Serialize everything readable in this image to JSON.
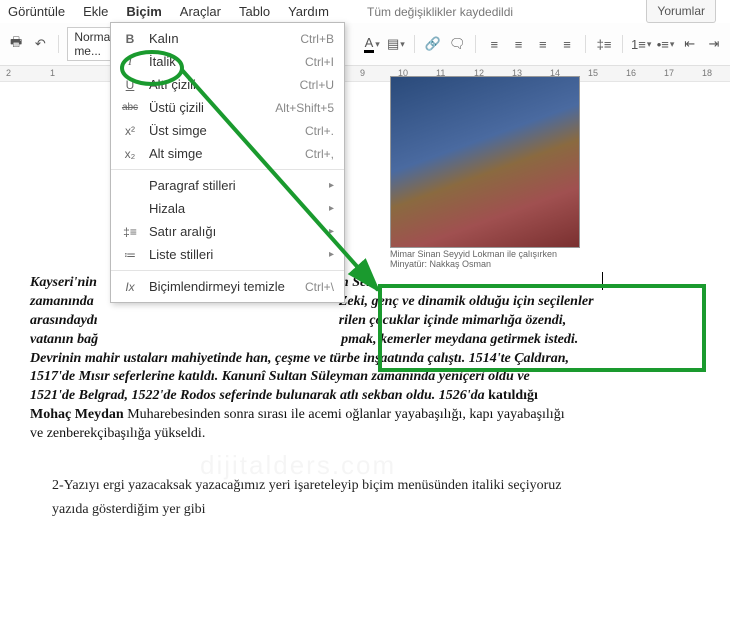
{
  "menubar": {
    "items": [
      "Görüntüle",
      "Ekle",
      "Biçim",
      "Araçlar",
      "Tablo",
      "Yardım"
    ],
    "active_index": 2,
    "status": "Tüm değişiklikler kaydedildi",
    "comment_button": "Yorumlar"
  },
  "toolbar": {
    "style_select": "Normal me...",
    "font_select": "",
    "font_color_letter": "A"
  },
  "dropdown": {
    "items": [
      {
        "icon": "B",
        "label": "Kalın",
        "shortcut": "Ctrl+B",
        "type": "item"
      },
      {
        "icon": "I",
        "label": "İtalik",
        "shortcut": "Ctrl+I",
        "type": "item"
      },
      {
        "icon": "U",
        "label": "Altı çizili",
        "shortcut": "Ctrl+U",
        "type": "item"
      },
      {
        "icon": "abc",
        "label": "Üstü çizili",
        "shortcut": "Alt+Shift+5",
        "type": "item"
      },
      {
        "icon": "x²",
        "label": "Üst simge",
        "shortcut": "Ctrl+.",
        "type": "item"
      },
      {
        "icon": "x₂",
        "label": "Alt simge",
        "shortcut": "Ctrl+,",
        "type": "item"
      },
      {
        "type": "sep"
      },
      {
        "icon": "",
        "label": "Paragraf stilleri",
        "submenu": true,
        "type": "item"
      },
      {
        "icon": "",
        "label": "Hizala",
        "submenu": true,
        "type": "item"
      },
      {
        "icon": "‡≡",
        "label": "Satır aralığı",
        "submenu": true,
        "type": "item"
      },
      {
        "icon": "≔",
        "label": "Liste stilleri",
        "submenu": true,
        "type": "item"
      },
      {
        "type": "sep"
      },
      {
        "icon": "Ix",
        "label": "Biçimlendirmeyi temizle",
        "shortcut": "Ctrl+\\",
        "type": "item"
      }
    ]
  },
  "ruler": {
    "left_numbers": [
      "2",
      "1"
    ],
    "right_numbers": [
      "9",
      "10",
      "11",
      "12",
      "13",
      "14",
      "15",
      "16",
      "17",
      "18"
    ]
  },
  "figure": {
    "caption_line1": "Mimar Sinan Seyyid Lokman ile çalışırken",
    "caption_line2": "Minyatür: Nakkaş Osman"
  },
  "document": {
    "p1_a": "Kayseri'nin",
    "p1_b": "an Sel",
    "p2_a": "zamanında",
    "p2_b": "Zeki, genç ve dinamik olduğu için seçilenler",
    "p3_a": "arasındaydı",
    "p3_b": "rilen çocuklar içinde mimarlığa özendi,",
    "p4_a": "vatanın bağ",
    "p4_b": "pmak, kemerler meydana getirmek istedi.",
    "p5": "Devrinin mahir ustaları mahiyetinde han, çeşme ve türbe inşaatında çalıştı. 1514'te Çaldıran,",
    "p6": "1517'de Mısır seferlerine katıldı. Kanunî Sultan Süleyman zamanında yeniçeri oldu ve",
    "p7": "1521'de Belgrad, 1522'de Rodos seferinde bulunarak atlı sekban oldu. 1526'da ",
    "p7b": "katıldığı",
    "p8a": "Mohaç Meydan ",
    "p8b": "Muharebesinden sonra sırası ile acemi oğlanlar yayabaşılığı, kapı yayabaşılığı",
    "p9": "ve zenberekçibaşılığa yükseldi."
  },
  "instruction": {
    "line1": "2-Yazıyı ergi yazacaksak yazacağımız yeri işareteleyip biçim menüsünden italiki seçiyoruz",
    "line2": "yazıda gösterdiğim yer gibi"
  },
  "annotation": {
    "circle_target": "italic-menu-item",
    "box_target": "italic-text-region",
    "color": "#1a9a2e"
  }
}
